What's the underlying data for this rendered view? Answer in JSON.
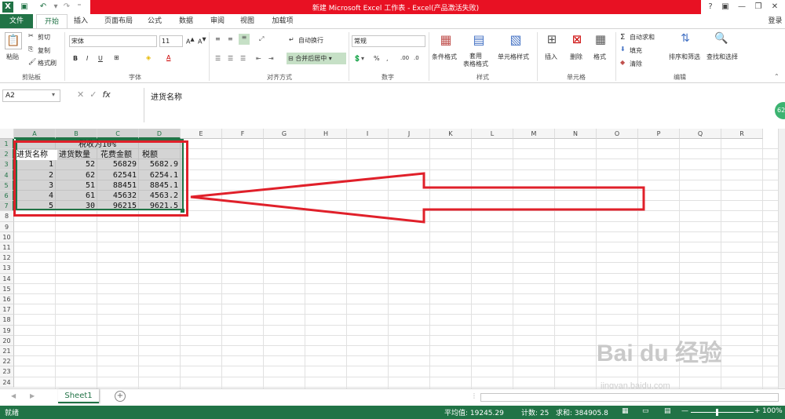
{
  "titlebar": {
    "title": "新建 Microsoft Excel 工作表 - Excel(产品激活失败)",
    "buttons": [
      "?",
      "▣",
      "—",
      "❐",
      "✕"
    ]
  },
  "tabs": [
    "文件",
    "开始",
    "插入",
    "页面布局",
    "公式",
    "数据",
    "审阅",
    "视图",
    "加载项"
  ],
  "login_label": "登录",
  "ribbon": {
    "clipboard": {
      "paste": "粘贴",
      "cut": "剪切",
      "copy": "复制",
      "format_painter": "格式刷",
      "group": "剪贴板"
    },
    "font": {
      "name": "宋体",
      "size": "11",
      "bold": "B",
      "italic": "I",
      "underline": "U",
      "group": "字体"
    },
    "alignment": {
      "wrap": "自动换行",
      "merge": "合并后居中",
      "group": "对齐方式"
    },
    "number": {
      "format": "常规",
      "percent": "%",
      "comma": ",",
      "group": "数字"
    },
    "styles": {
      "cond": "条件格式",
      "table": "套用\n表格格式",
      "cell": "单元格样式",
      "group": "样式"
    },
    "cells": {
      "insert": "插入",
      "delete": "删除",
      "format": "格式",
      "group": "单元格"
    },
    "editing": {
      "autosum": "自动求和",
      "fill": "填充",
      "clear": "清除",
      "sort": "排序和筛选",
      "find": "查找和选择",
      "group": "编辑"
    }
  },
  "formula_bar": {
    "name_box": "A2",
    "fx": "fx",
    "content": "进货名称"
  },
  "columns": [
    "A",
    "B",
    "C",
    "D",
    "E",
    "F",
    "G",
    "H",
    "I",
    "J",
    "K",
    "L",
    "M",
    "N",
    "O",
    "P",
    "Q",
    "R"
  ],
  "rows": [
    "1",
    "2",
    "3",
    "4",
    "5",
    "6",
    "7",
    "8",
    "9",
    "10",
    "11",
    "12",
    "13",
    "14",
    "15",
    "16",
    "17",
    "18",
    "19",
    "20",
    "21",
    "22",
    "23",
    "24"
  ],
  "sheet": {
    "title": "税收为10%",
    "headers": [
      "进货名称",
      "进货数量",
      "花费金额",
      "税额"
    ],
    "data": [
      [
        "1",
        "52",
        "56829",
        "5682.9"
      ],
      [
        "2",
        "62",
        "62541",
        "6254.1"
      ],
      [
        "3",
        "51",
        "88451",
        "8845.1"
      ],
      [
        "4",
        "61",
        "45632",
        "4563.2"
      ],
      [
        "5",
        "30",
        "96215",
        "9621.5"
      ]
    ]
  },
  "sheet_tabs": {
    "active": "Sheet1",
    "add": "+"
  },
  "status": {
    "ready": "就绪",
    "average": "平均值: 19245.29",
    "count": "计数: 25",
    "sum": "求和: 384905.8",
    "zoom": "100%"
  },
  "badge": "62",
  "watermark": {
    "brand": "Bai du 经验",
    "url": "jingyan.baidu.com"
  },
  "colors": {
    "excel_green": "#217346",
    "title_red": "#e81123",
    "annotation_red": "#e0202a"
  }
}
